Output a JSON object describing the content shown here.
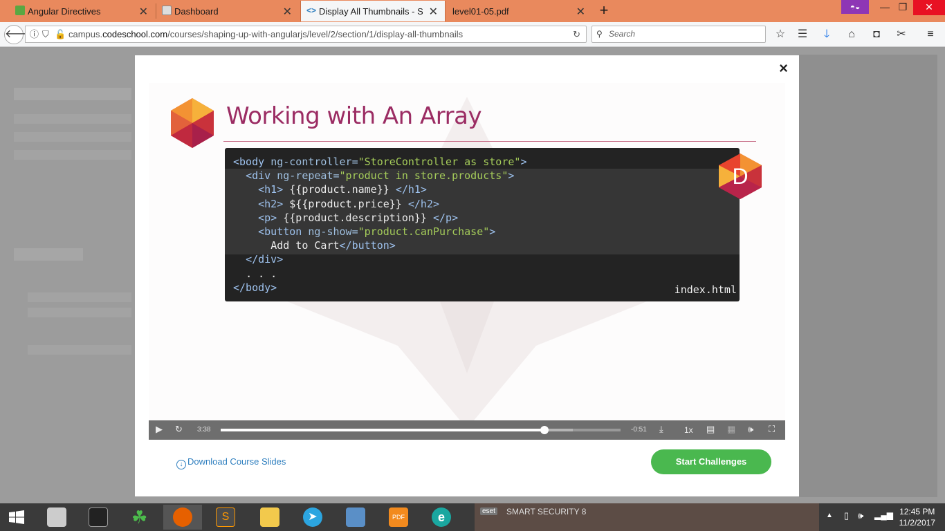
{
  "browser": {
    "tabs": [
      {
        "title": "Angular Directives",
        "active": false
      },
      {
        "title": "Dashboard",
        "active": false
      },
      {
        "title": "Display All Thumbnails - Sha",
        "active": true
      },
      {
        "title": "level01-05.pdf",
        "active": false
      }
    ],
    "new_tab": "+",
    "window_controls": {
      "minimize": "—",
      "restore": "❐",
      "close": "✕"
    },
    "url": {
      "prefix": "campus.",
      "domain": "codeschool.com",
      "path": "/courses/shaping-up-with-angularjs/level/2/section/1/display-all-thumbnails"
    },
    "search_placeholder": "Search"
  },
  "modal": {
    "close": "×",
    "video": {
      "slide_title": "Working with An Array",
      "badge_letter": "D",
      "code_lines": [
        {
          "indent": 0,
          "parts": [
            [
              "tg",
              "<body "
            ],
            [
              "at",
              "ng-controller="
            ],
            [
              "st",
              "\"StoreController as store\""
            ],
            [
              "tg",
              ">"
            ]
          ]
        },
        {
          "indent": 2,
          "parts": [
            [
              "tg",
              "<div "
            ],
            [
              "at",
              "ng-repeat="
            ],
            [
              "st",
              "\"product in store.products\""
            ],
            [
              "tg",
              ">"
            ]
          ]
        },
        {
          "indent": 4,
          "parts": [
            [
              "tg",
              "<h1>"
            ],
            [
              "tx",
              " {{product.name}} "
            ],
            [
              "tg",
              "</h1>"
            ]
          ]
        },
        {
          "indent": 4,
          "parts": [
            [
              "tg",
              "<h2>"
            ],
            [
              "tx",
              " ${{product.price}} "
            ],
            [
              "tg",
              "</h2>"
            ]
          ]
        },
        {
          "indent": 4,
          "parts": [
            [
              "tg",
              "<p>"
            ],
            [
              "tx",
              " {{product.description}} "
            ],
            [
              "tg",
              "</p>"
            ]
          ]
        },
        {
          "indent": 4,
          "parts": [
            [
              "tg",
              "<button "
            ],
            [
              "at",
              "ng-show="
            ],
            [
              "st",
              "\"product.canPurchase\""
            ],
            [
              "tg",
              ">"
            ]
          ]
        },
        {
          "indent": 6,
          "parts": [
            [
              "tx",
              "Add to Cart"
            ],
            [
              "tg",
              "</button>"
            ]
          ]
        },
        {
          "indent": 2,
          "parts": [
            [
              "tg",
              "</div>"
            ]
          ]
        },
        {
          "indent": 2,
          "parts": [
            [
              "tx",
              ". . ."
            ]
          ]
        },
        {
          "indent": 0,
          "parts": [
            [
              "tg",
              "</body>"
            ]
          ]
        }
      ],
      "file_name": "index.html",
      "controls": {
        "elapsed": "3:38",
        "remaining": "-0:51",
        "progress": 0.81,
        "buffered": 0.88,
        "speed": "1x"
      }
    },
    "download_link": "Download Course Slides",
    "start_button": "Start Challenges"
  },
  "taskbar": {
    "eset_logo": "eset",
    "eset_label": "SMART SECURITY 8",
    "clock_time": "12:45 PM",
    "clock_date": "11/2/2017"
  }
}
